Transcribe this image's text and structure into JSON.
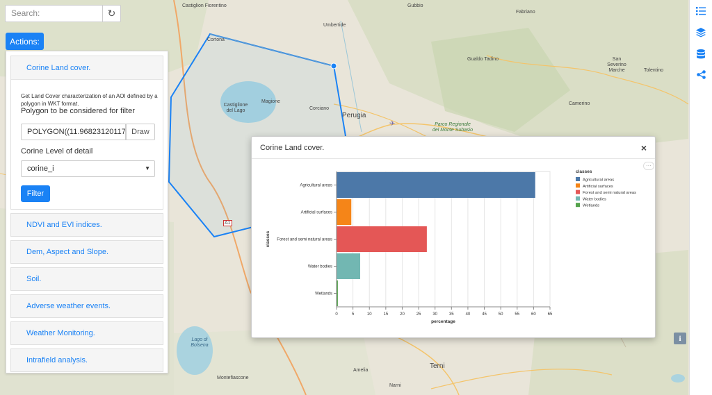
{
  "map": {
    "labels": [
      "Castiglion Fiorentino",
      "Umbertide",
      "Gubbio",
      "Fabriano",
      "Cortona",
      "Gualdo Tadino",
      "San Severino Marche",
      "Tolentino",
      "Castiglione del Lago",
      "Magione",
      "Corciano",
      "Perugia",
      "Parco Regionale del Monte Subasio",
      "Camerino",
      "Lago di Bolsena",
      "Montefiascone",
      "Terni",
      "Amelia",
      "Narni",
      "A1"
    ]
  },
  "search": {
    "placeholder": "Search:"
  },
  "actions": {
    "label": "Actions:"
  },
  "panel": {
    "open_section": {
      "title": "Corine Land cover.",
      "description": "Get Land Cover characterization of an AOI defined by a polygon in WKT format.",
      "polygon_label": "Polygon to be considered for filter",
      "polygon_value": "POLYGON((11.96823120117",
      "draw_label": "Draw",
      "level_label": "Corine Level of detail",
      "level_value": "corine_i",
      "filter_label": "Filter"
    },
    "sections": [
      "NDVI and EVI indices.",
      "Dem, Aspect and Slope.",
      "Soil.",
      "Adverse weather events.",
      "Weather Monitoring.",
      "Intrafield analysis."
    ]
  },
  "toolbar": {
    "icons": [
      "list-icon",
      "layers-icon",
      "database-icon",
      "share-icon"
    ],
    "accent": "#1a82f5",
    "info_label": "i"
  },
  "modal": {
    "title": "Corine Land cover.",
    "close_label": "×",
    "more_label": "···"
  },
  "chart_data": {
    "type": "bar",
    "orientation": "horizontal",
    "categories": [
      "Agricultural areas",
      "Artificial surfaces",
      "Forest and semi natural areas",
      "Water bodies",
      "Wetlands"
    ],
    "values": [
      60.5,
      4.5,
      27.5,
      7.2,
      0.4
    ],
    "colors": [
      "#4c78a8",
      "#f58518",
      "#e45756",
      "#72b7b2",
      "#54a24b"
    ],
    "xlabel": "percentage",
    "ylabel": "classes",
    "xlim": [
      0,
      65
    ],
    "xticks": [
      0,
      5,
      10,
      15,
      20,
      25,
      30,
      35,
      40,
      45,
      50,
      55,
      60,
      65
    ],
    "grid": true,
    "legend": {
      "title": "classes",
      "placement": "right"
    }
  }
}
